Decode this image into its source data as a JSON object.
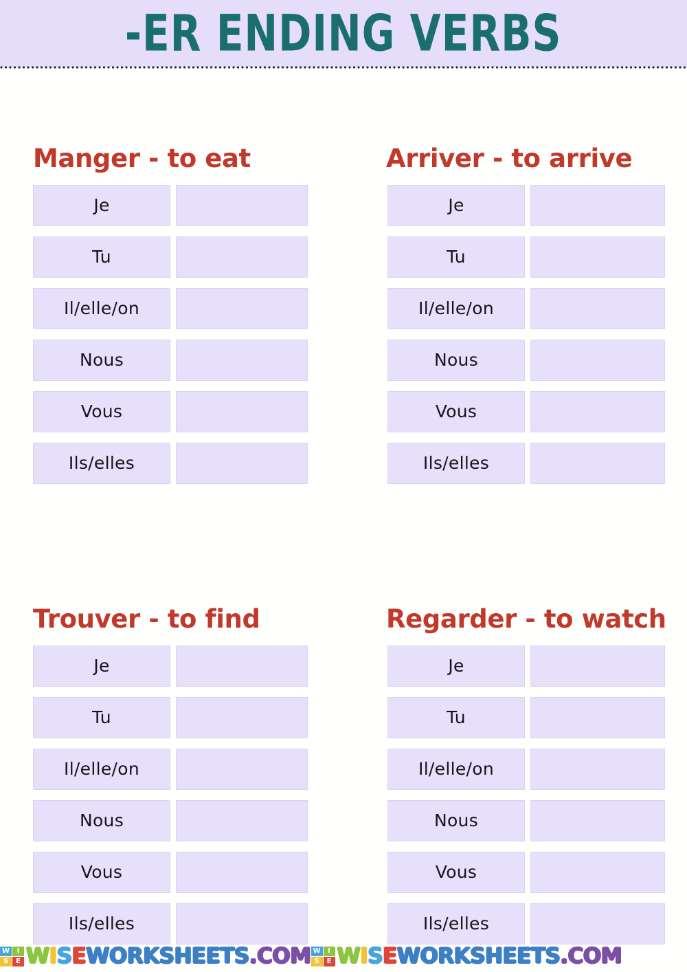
{
  "header": {
    "title": "-ER ENDING VERBS",
    "title_color": "#1A6E6E",
    "background_color": "#E6DDFB"
  },
  "colors": {
    "heading_red": "#C0392B",
    "cell_fill": "#E7E0FA",
    "page_background": "#FFFFFE"
  },
  "pronouns": [
    "Je",
    "Tu",
    "Il/elle/on",
    "Nous",
    "Vous",
    "Ils/elles"
  ],
  "verbs": [
    {
      "heading": "Manger - to eat",
      "infinitive": "Manger",
      "translation": "to eat",
      "rows": [
        {
          "pronoun": "Je",
          "answer": ""
        },
        {
          "pronoun": "Tu",
          "answer": ""
        },
        {
          "pronoun": "Il/elle/on",
          "answer": ""
        },
        {
          "pronoun": "Nous",
          "answer": ""
        },
        {
          "pronoun": "Vous",
          "answer": ""
        },
        {
          "pronoun": "Ils/elles",
          "answer": ""
        }
      ]
    },
    {
      "heading": "Arriver - to arrive",
      "infinitive": "Arriver",
      "translation": "to arrive",
      "rows": [
        {
          "pronoun": "Je",
          "answer": ""
        },
        {
          "pronoun": "Tu",
          "answer": ""
        },
        {
          "pronoun": "Il/elle/on",
          "answer": ""
        },
        {
          "pronoun": "Nous",
          "answer": ""
        },
        {
          "pronoun": "Vous",
          "answer": ""
        },
        {
          "pronoun": "Ils/elles",
          "answer": ""
        }
      ]
    },
    {
      "heading": "Trouver - to find",
      "infinitive": "Trouver",
      "translation": "to find",
      "rows": [
        {
          "pronoun": "Je",
          "answer": ""
        },
        {
          "pronoun": "Tu",
          "answer": ""
        },
        {
          "pronoun": "Il/elle/on",
          "answer": ""
        },
        {
          "pronoun": "Nous",
          "answer": ""
        },
        {
          "pronoun": "Vous",
          "answer": ""
        },
        {
          "pronoun": "Ils/elles",
          "answer": ""
        }
      ]
    },
    {
      "heading": "Regarder - to watch",
      "infinitive": "Regarder",
      "translation": "to watch",
      "rows": [
        {
          "pronoun": "Je",
          "answer": ""
        },
        {
          "pronoun": "Tu",
          "answer": ""
        },
        {
          "pronoun": "Il/elle/on",
          "answer": ""
        },
        {
          "pronoun": "Nous",
          "answer": ""
        },
        {
          "pronoun": "Vous",
          "answer": ""
        },
        {
          "pronoun": "Ils/elles",
          "answer": ""
        }
      ]
    }
  ],
  "footer": {
    "badge_letters": [
      "W",
      "I",
      "S",
      "E"
    ],
    "watermark_text": "WISEWORKSHEETS.COM",
    "watermark_parts": [
      "W",
      "I",
      "S",
      "E",
      "WORKSHEETS",
      ".COM"
    ],
    "repeat_count": 2
  }
}
